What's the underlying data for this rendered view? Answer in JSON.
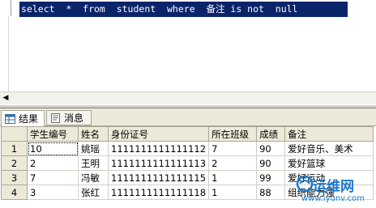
{
  "editor": {
    "sql": "select  *  from  student  where  备注 is not  null"
  },
  "tabs": [
    {
      "label": "结果"
    },
    {
      "label": "消息"
    }
  ],
  "grid": {
    "columns": [
      "学生编号",
      "姓名",
      "身份证号",
      "所在班级",
      "成绩",
      "备注"
    ],
    "rows": [
      {
        "num": "1",
        "cells": [
          "10",
          "姚瑶",
          "1111111111111112",
          "7",
          "90",
          "爱好音乐、美术"
        ]
      },
      {
        "num": "2",
        "cells": [
          "2",
          "王明",
          "1111111111111113",
          "2",
          "90",
          "爱好篮球"
        ]
      },
      {
        "num": "3",
        "cells": [
          "7",
          "冯敏",
          "1111111111111115",
          "1",
          "99",
          "爱好运动"
        ]
      },
      {
        "num": "4",
        "cells": [
          "3",
          "张红",
          "1111111111111118",
          "1",
          "88",
          "组织能力强"
        ]
      }
    ]
  },
  "watermark": {
    "text": "运维网",
    "url": "www.iyunv.com"
  },
  "colors": {
    "selection": "#0a246a",
    "chrome": "#ece9d8",
    "watermark": "#1c78c8"
  }
}
